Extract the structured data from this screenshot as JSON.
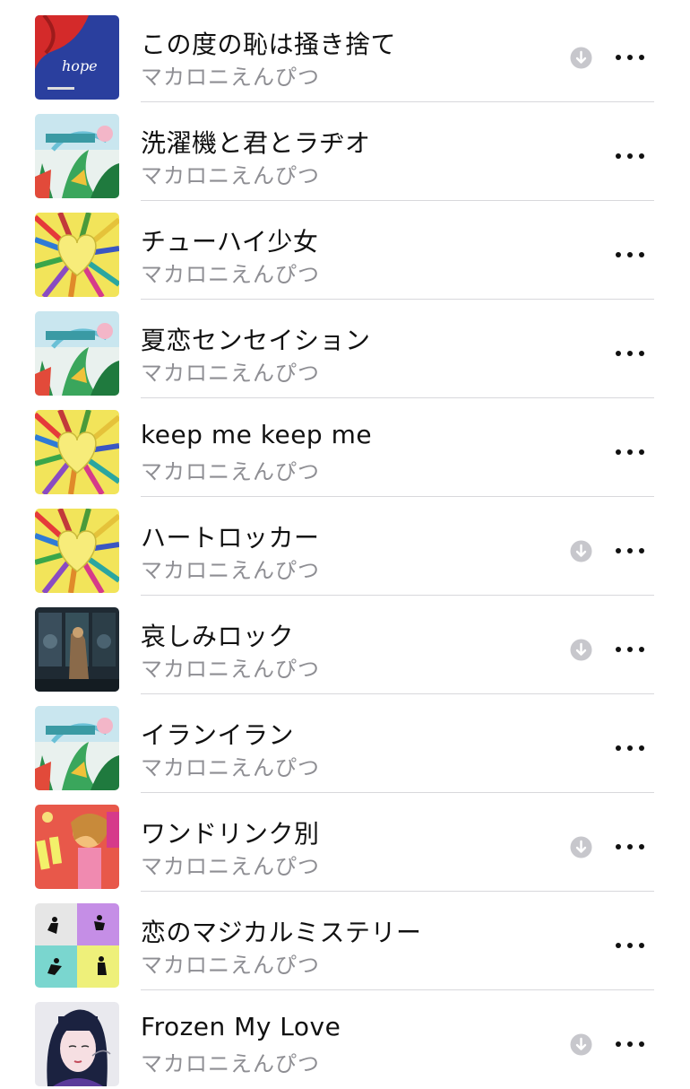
{
  "tracks": [
    {
      "title": "この度の恥は掻き捨て",
      "artist": "マカロニえんぴつ",
      "art": "hope",
      "downloaded": true,
      "art_caption": "hope"
    },
    {
      "title": "洗濯機と君とラヂオ",
      "artist": "マカロニえんぴつ",
      "art": "jungle",
      "downloaded": false
    },
    {
      "title": "チューハイ少女",
      "artist": "マカロニえんぴつ",
      "art": "pencils",
      "downloaded": false
    },
    {
      "title": "夏恋センセイション",
      "artist": "マカロニえんぴつ",
      "art": "jungle",
      "downloaded": false
    },
    {
      "title": "keep me keep me",
      "artist": "マカロニえんぴつ",
      "art": "pencils",
      "downloaded": false
    },
    {
      "title": "ハートロッカー",
      "artist": "マカロニえんぴつ",
      "art": "pencils",
      "downloaded": true
    },
    {
      "title": "哀しみロック",
      "artist": "マカロニえんぴつ",
      "art": "laundry",
      "downloaded": true
    },
    {
      "title": "イランイラン",
      "artist": "マカロニえんぴつ",
      "art": "jungle",
      "downloaded": false
    },
    {
      "title": "ワンドリンク別",
      "artist": "マカロニえんぴつ",
      "art": "girl",
      "downloaded": true
    },
    {
      "title": "恋のマジカルミステリー",
      "artist": "マカロニえんぴつ",
      "art": "quad",
      "downloaded": false
    },
    {
      "title": "Frozen My Love",
      "artist": "マカロニえんぴつ",
      "art": "portrait",
      "downloaded": true
    }
  ],
  "colors": {
    "title": "#111111",
    "artist": "#8e8e93",
    "divider": "#d8d8dc",
    "download_icon": "#c7c7cc"
  },
  "icons": {
    "download": "arrow-down-circle-icon",
    "more": "ellipsis-icon"
  }
}
